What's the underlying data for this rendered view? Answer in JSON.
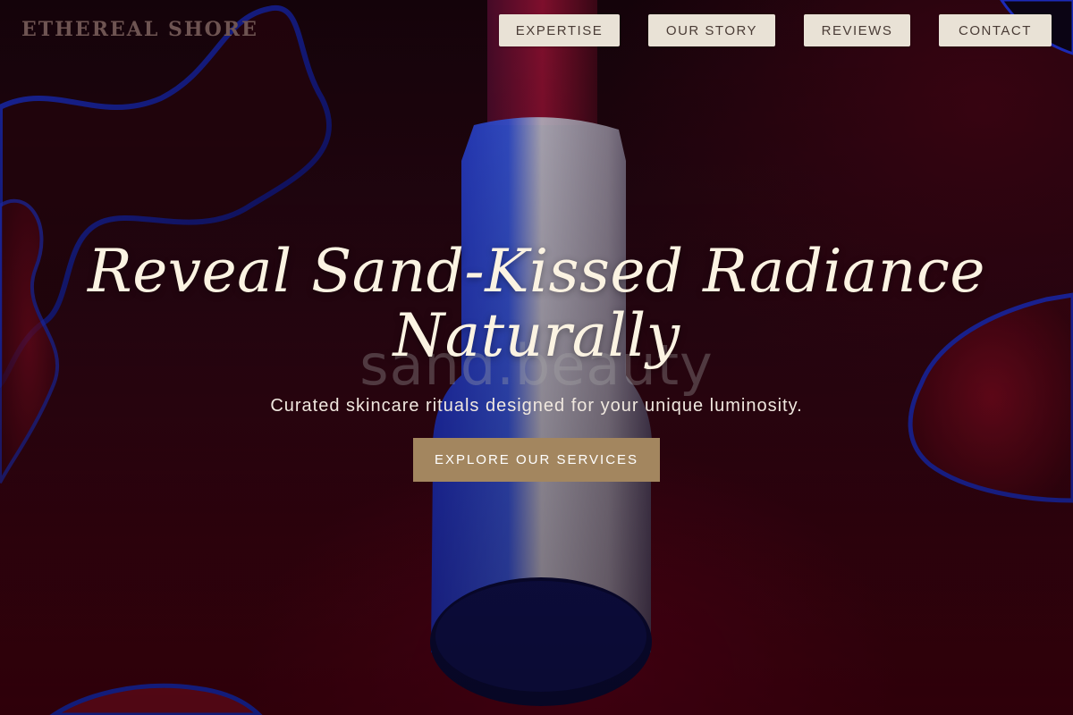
{
  "header": {
    "brand": "ETHEREAL SHORE",
    "nav": [
      {
        "label": "EXPERTISE"
      },
      {
        "label": "OUR STORY"
      },
      {
        "label": "REVIEWS"
      },
      {
        "label": "CONTACT"
      }
    ]
  },
  "hero": {
    "title_line1": "Reveal Sand-Kissed Radiance",
    "title_line2": "Naturally",
    "subtitle": "Curated skincare rituals designed for your unique luminosity.",
    "cta_label": "EXPLORE OUR SERVICES",
    "watermark": "sand.beauty",
    "background_image": "lipstick-on-red-liquid"
  },
  "colors": {
    "background": "#2a0612",
    "accent": "#a3865f",
    "nav_button": "#e9e2d6",
    "title_text": "#fbf3e2"
  }
}
